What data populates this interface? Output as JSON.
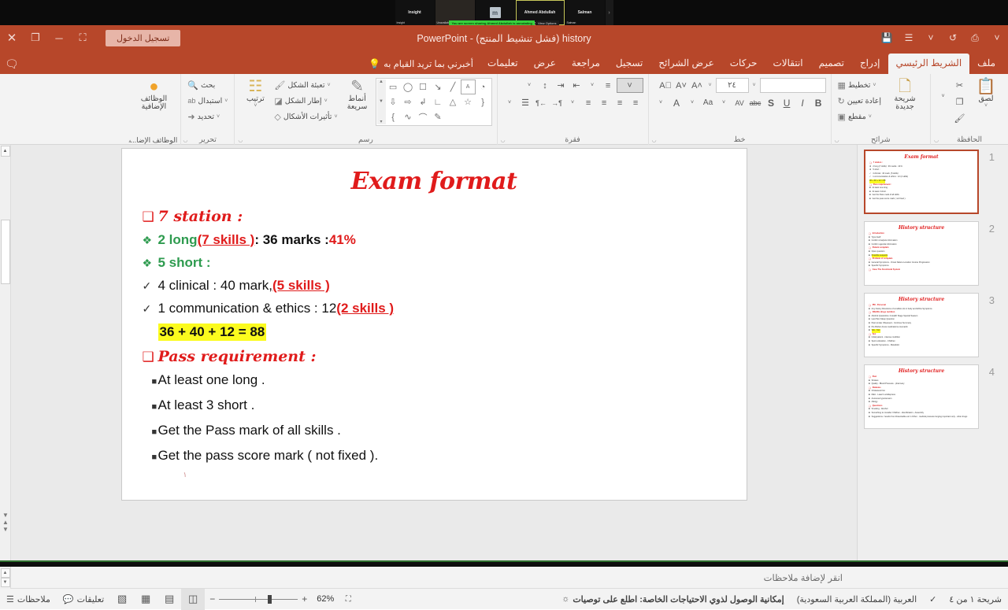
{
  "conference": {
    "tiles": [
      {
        "name": "Insight",
        "center": "Insight",
        "kind": "dark"
      },
      {
        "name": "Unavailable",
        "center": "",
        "kind": "photo"
      },
      {
        "name": "Maya Muhammad",
        "center": "m",
        "kind": "avatar"
      },
      {
        "name": "Ahmed Abdullah",
        "center": "Ahmed Abdullah",
        "kind": "active"
      },
      {
        "name": "Salman",
        "center": "Salman",
        "kind": "dark"
      }
    ],
    "share_banner": "You are screen sharing  Ahmed Abdullah is annotating",
    "view_options": "View Options",
    "next_arrow": "›"
  },
  "titlebar": {
    "title": "history (فشل تنشيط المنتج)  -  PowerPoint",
    "signin_label": "تسجيل الدخول",
    "close_icon": "✕",
    "restore_icon": "❐",
    "minimize_icon": "─",
    "ribbon_display_icon": "⛶",
    "comment_icon": "⌨",
    "right_icons": [
      "˅",
      "⎙",
      "↺",
      "˅",
      "☰",
      "💾"
    ]
  },
  "tabs": [
    {
      "label": "ملف",
      "active": false
    },
    {
      "label": "الشريط الرئيسي",
      "active": true
    },
    {
      "label": "إدراج",
      "active": false
    },
    {
      "label": "تصميم",
      "active": false
    },
    {
      "label": "انتقالات",
      "active": false
    },
    {
      "label": "حركات",
      "active": false
    },
    {
      "label": "عرض الشرائح",
      "active": false
    },
    {
      "label": "تسجيل",
      "active": false
    },
    {
      "label": "مراجعة",
      "active": false
    },
    {
      "label": "عرض",
      "active": false
    },
    {
      "label": "تعليمات",
      "active": false
    }
  ],
  "tellme": "أخبرني بما تريد القيام به",
  "ribbon": {
    "clipboard": {
      "label": "الحافظة",
      "paste": "لصق",
      "cut": "✂",
      "copy": "❐",
      "format_painter": "🖌"
    },
    "slides": {
      "label": "شرائح",
      "new_slide": "شريحة جديدة",
      "layout": "تخطيط",
      "reset": "إعادة تعيين",
      "section": "مقطع"
    },
    "font": {
      "label": "خط",
      "font_name": "",
      "font_size": "٢٤",
      "bold": "B",
      "italic": "I",
      "underline": "U",
      "shadow": "S",
      "strikethrough": "abc",
      "char_spacing": "AV",
      "change_case": "Aa",
      "font_color": "A",
      "grow_font": "A˄",
      "shrink_font": "A˅",
      "clear_formatting": "A⃠"
    },
    "paragraph": {
      "label": "فقرة",
      "bullets": "≡",
      "numbering": "≣",
      "decrease_indent": "⇤",
      "increase_indent": "⇥",
      "line_spacing": "↕",
      "align_left": "≡",
      "align_center": "≡",
      "align_right": "≡",
      "justify": "≡",
      "columns": "☰",
      "ltr": "¶←",
      "rtl": "→¶"
    },
    "drawing": {
      "label": "رسم",
      "arrange": "ترتيب",
      "quick_styles": "أنماط سريعة",
      "shape_fill": "تعبئة الشكل",
      "shape_outline": "إطار الشكل",
      "shape_effects": "تأثيرات الأشكال",
      "shapes": [
        "▭",
        "◯",
        "□",
        "╲",
        "╲",
        "A",
        "◔",
        "⇩",
        "⇨",
        "⤷",
        "⤵",
        "△",
        "☆",
        "}",
        "{",
        "∿",
        "⌒",
        "✎"
      ]
    },
    "editing": {
      "label": "تحرير",
      "find": "بحث",
      "replace": "استبدال",
      "select": "تحديد"
    },
    "addins": {
      "label": "الوظائف الإضا...",
      "button": "الوظائف الإضافية"
    }
  },
  "slide": {
    "title": "Exam format",
    "lines": [
      {
        "bullet": "square",
        "parts": [
          {
            "t": "7 station :",
            "style": "serif-red"
          }
        ]
      },
      {
        "bullet": "diamond",
        "parts": [
          {
            "t": "2 long ",
            "style": "green-bold"
          },
          {
            "t": "(7 skills )",
            "style": "underline-red"
          },
          {
            "t": " : 36 marks  : ",
            "style": "black-bold"
          },
          {
            "t": "41%",
            "style": "red-bold"
          }
        ]
      },
      {
        "bullet": "diamond",
        "parts": [
          {
            "t": "5 short :",
            "style": "green-bold"
          }
        ]
      },
      {
        "bullet": "check",
        "parts": [
          {
            "t": "4 clinical  : 40 mark, ",
            "style": "black"
          },
          {
            "t": "(5 skills )",
            "style": "underline-red"
          }
        ]
      },
      {
        "bullet": "check",
        "parts": [
          {
            "t": "1 communication & ethics : 12 ",
            "style": "black"
          },
          {
            "t": "(2 skills )",
            "style": "underline-red"
          }
        ]
      },
      {
        "bullet": "none",
        "parts": [
          {
            "t": "36 + 40 + 12 = 88",
            "style": "highlight"
          }
        ]
      },
      {
        "bullet": "square",
        "parts": [
          {
            "t": "Pass requirement :",
            "style": "serif-red"
          }
        ]
      },
      {
        "bullet": "small",
        "parts": [
          {
            "t": "At least one long .",
            "style": "black"
          }
        ]
      },
      {
        "bullet": "small",
        "parts": [
          {
            "t": "At least 3 short .",
            "style": "black"
          }
        ]
      },
      {
        "bullet": "small",
        "parts": [
          {
            "t": " Get the Pass  mark of all skills .",
            "style": "black"
          }
        ]
      },
      {
        "bullet": "small",
        "parts": [
          {
            "t": "Get  the pass score mark ( not fixed ).",
            "style": "black"
          }
        ]
      }
    ],
    "trailing_mark": "١"
  },
  "thumbnails": [
    {
      "num": "1",
      "title": "Exam format",
      "selected": true,
      "lines": [
        "7 station :",
        "2 long (7 skills) : 36 marks : 41%",
        "5 short :",
        "4 clinical : 40 mark, (5 skills)",
        "1 communication & ethics : 12 (2 skills)",
        "36 + 40 + 12 = 88",
        "Pass requirement :",
        "At least one long .",
        "At least 3 short .",
        "Get the Pass mark of all skills .",
        "Get the pass score mark ( not fixed )."
      ]
    },
    {
      "num": "2",
      "title": "History structure",
      "selected": false,
      "lines": [
        "Introduction",
        "Type itself",
        "Confirm Analysis information",
        "Confirm agenda information",
        "Patient complain",
        "Open question",
        "Possible suspects",
        "Problem of complain",
        "General Symptoms - Onset Nature Location Course Progression",
        "Specific Symptoms",
        "Case The Functional System"
      ]
    },
    {
      "num": "3",
      "title": "History structure",
      "selected": false,
      "lines": [
        "PM - Personal",
        "Any history Directions of condition do in body and EXtra Symptoms",
        "NSAIDs drugs nutrition",
        "Alcohol Quarantine 1 Health Stage Special Season",
        "Last Pain Sleep Question",
        "Past smoke Obsessed - Continue Summary",
        "Pre Bother Acute medications coumadin",
        "Vas - Sex",
        "Sex",
        "Initial patient - intense condition",
        "Sport education - Children",
        "Specific Symptoms - Metabolic"
      ]
    },
    {
      "num": "4",
      "title": "History structure",
      "selected": false,
      "lines": [
        "Past",
        "Strokes",
        "Quality - Blood Pressure - pharmacy",
        "Diabetes",
        "Cholesterol list",
        "Main - Laser's antidepress",
        "Anorexia hypertension",
        "Allergy",
        "Questions",
        "Smoking - Alcohol",
        "Something to consider Children - identification - Assembly",
        "Suggestions / results from Dissolvable etc in Other - medical pressure longing important only - other drugs"
      ]
    }
  ],
  "notes": {
    "prompt": "انقر لإضافة ملاحظات"
  },
  "statusbar": {
    "slide_counter": "شريحة ١ من ٤",
    "proofing_icon": "✓",
    "language": "العربية (المملكة العربية السعودية)",
    "accessibility": "إمكانية الوصول لذوي الاحتياجات الخاصة: اطلع على توصيات",
    "accessibility_icon": "☼",
    "notes_label": "ملاحظات",
    "comments_label": "تعليقات",
    "zoom_value": "62%",
    "zoom_minus": "−",
    "zoom_plus": "+",
    "fit_icon": "⛶",
    "views": [
      {
        "name": "normal-view",
        "icon": "▤",
        "active": true
      },
      {
        "name": "slide-sorter-view",
        "icon": "▦",
        "active": false
      },
      {
        "name": "reading-view",
        "icon": "▧",
        "active": false
      },
      {
        "name": "slideshow-view",
        "icon": "▭",
        "active": false
      }
    ]
  }
}
